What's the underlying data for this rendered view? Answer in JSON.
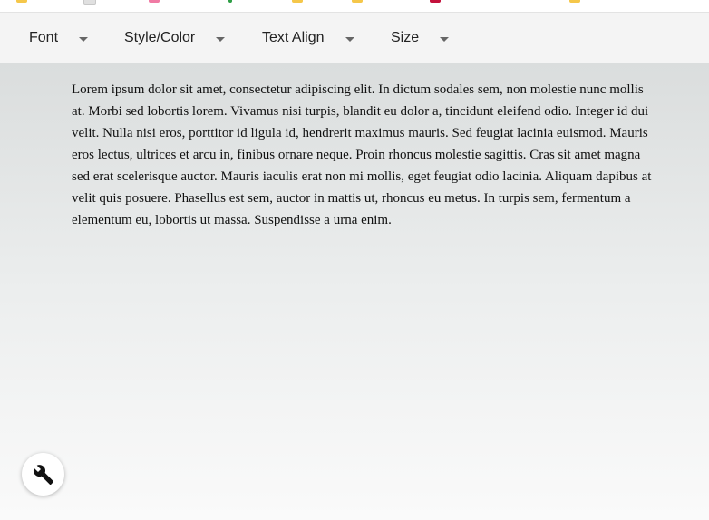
{
  "toolbar": {
    "menus": [
      {
        "label": "Font"
      },
      {
        "label": "Style/Color"
      },
      {
        "label": "Text Align"
      },
      {
        "label": "Size"
      }
    ]
  },
  "content": {
    "paragraph": "Lorem ipsum dolor sit amet, consectetur adipiscing elit. In dictum sodales sem, non molestie nunc mollis at. Morbi sed lobortis lorem. Vivamus nisi turpis, blandit eu dolor a, tincidunt eleifend odio. Integer id dui velit. Nulla nisi eros, porttitor id ligula id, hendrerit maximus mauris. Sed feugiat lacinia euismod. Mauris eros lectus, ultrices et arcu in, finibus ornare neque. Proin rhoncus molestie sagittis. Cras sit amet magna sed erat scelerisque auctor. Mauris iaculis erat non mi mollis, eget feugiat odio lacinia. Aliquam dapibus at velit quis posuere. Phasellus est sem, auctor in mattis ut, rhoncus eu metus. In turpis sem, fermentum a elementum eu, lobortis ut massa. Suspendisse a urna enim."
  },
  "fab": {
    "icon": "wrench-icon"
  },
  "colors": {
    "toolbar_bg": "#f4f4f4",
    "bookmark_folder": "#f5c74a",
    "bookmark_pink": "#f07aa4",
    "bookmark_green": "#2e9e45",
    "bookmark_red": "#c3113c",
    "gradient_top": "#dadddd",
    "gradient_bottom": "#fafafa"
  }
}
